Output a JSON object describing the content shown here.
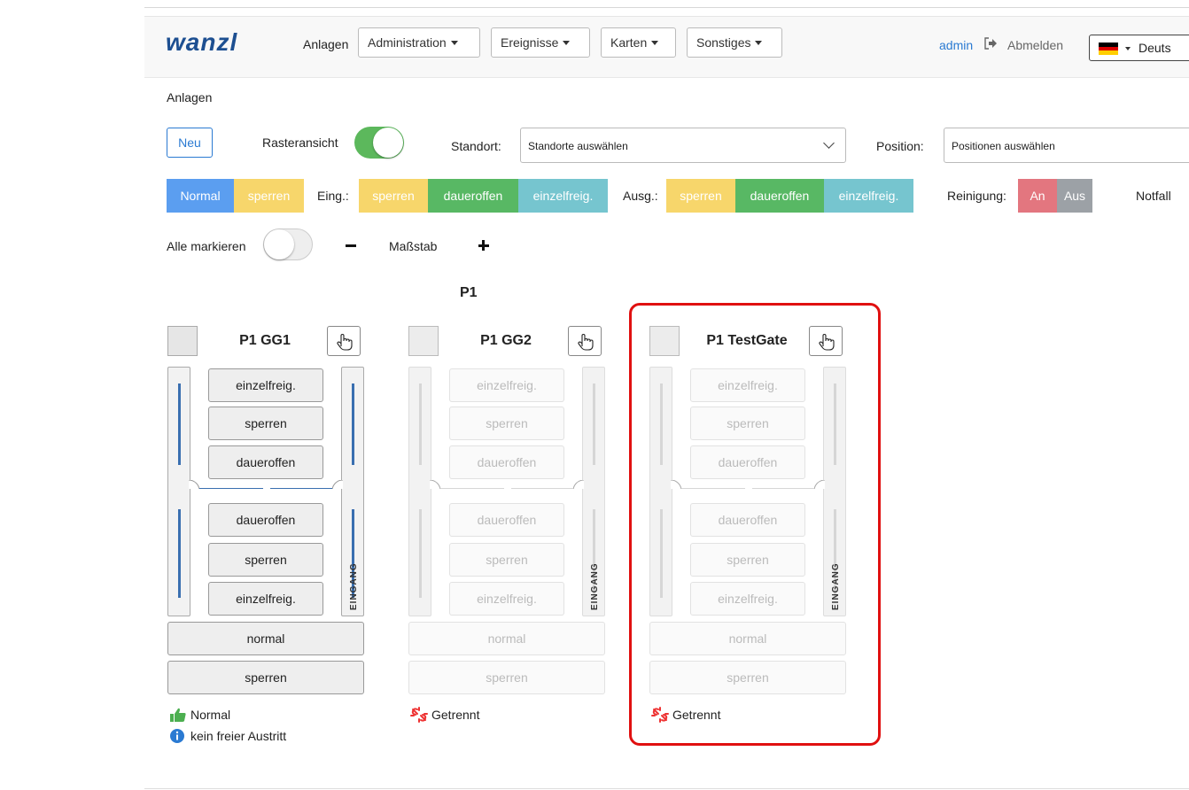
{
  "navbar": {
    "logo": "wanzl",
    "anlagen": "Anlagen",
    "menus": [
      "Administration",
      "Ereignisse",
      "Karten",
      "Sonstiges"
    ],
    "user": "admin",
    "logout": "Abmelden",
    "language": "Deuts"
  },
  "breadcrumb": "Anlagen",
  "toolbar": {
    "new_label": "Neu",
    "grid_label": "Rasteransicht",
    "grid_on": true,
    "location_label": "Standort:",
    "location_placeholder": "Standorte auswählen",
    "position_label": "Position:",
    "position_placeholder": "Positionen auswählen"
  },
  "modes": {
    "normal": "Normal",
    "sperren": "sperren",
    "eing_label": "Eing.:",
    "ausg_label": "Ausg.:",
    "sperren2": "sperren",
    "daueroffen": "daueroffen",
    "einzelfreig": "einzelfreig.",
    "reinigung_label": "Reinigung:",
    "an": "An",
    "aus": "Aus",
    "notfall": "Notfall"
  },
  "view": {
    "select_all": "Alle markieren",
    "scale": "Maßstab"
  },
  "group": "P1",
  "gates": [
    {
      "title": "P1 GG1",
      "status": "Normal",
      "info": "kein freier Austritt",
      "connected": true
    },
    {
      "title": "P1 GG2",
      "status": "Getrennt",
      "connected": false
    },
    {
      "title": "P1 TestGate",
      "status": "Getrennt",
      "connected": false
    }
  ],
  "gate_buttons": {
    "top": [
      "einzelfreig.",
      "sperren",
      "daueroffen"
    ],
    "bottom": [
      "daueroffen",
      "sperren",
      "einzelfreig."
    ],
    "wide": [
      "normal",
      "sperren"
    ],
    "side": "EINGANG"
  },
  "colors": {
    "accent": "#2a7ad2",
    "normal": "#5b9ef0",
    "sperren": "#f7d66b",
    "daueroffen": "#58b864",
    "einzelfreig": "#76c5cf",
    "an": "#e3767f",
    "aus": "#9ca1a6",
    "highlight": "#e01010"
  }
}
